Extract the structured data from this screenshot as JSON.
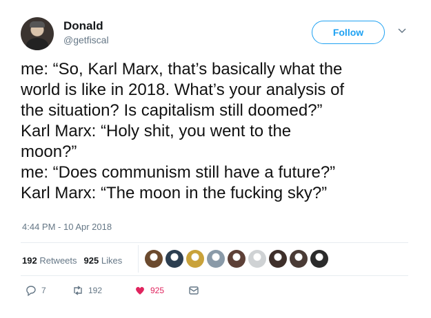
{
  "user": {
    "name": "Donald",
    "handle": "@getfiscal"
  },
  "follow_label": "Follow",
  "tweet": {
    "lines": [
      "me: “So, Karl Marx, that’s basically what the",
      "world is like in 2018. What’s your analysis of",
      "the situation? Is capitalism still doomed?”",
      "Karl Marx: “Holy shit, you went to the",
      "moon?”",
      "me: “Does communism still have a future?”",
      "Karl Marx: “The moon in the fucking sky?”"
    ],
    "timestamp": "4:44 PM - 10 Apr 2018"
  },
  "stats": {
    "retweets_count": "192",
    "retweets_label": "Retweets",
    "likes_count": "925",
    "likes_label": "Likes"
  },
  "likers_colors": [
    "#6b4a2e",
    "#2c3e50",
    "#c9a23a",
    "#8a9aa8",
    "#5d4037",
    "#cfd2d4",
    "#3e2f2a",
    "#4a3b35",
    "#2b2b2b"
  ],
  "actions": {
    "reply_count": "7",
    "retweet_count": "192",
    "like_count": "925"
  },
  "colors": {
    "accent": "#1da1f2",
    "like": "#e0245e",
    "muted": "#657786"
  }
}
